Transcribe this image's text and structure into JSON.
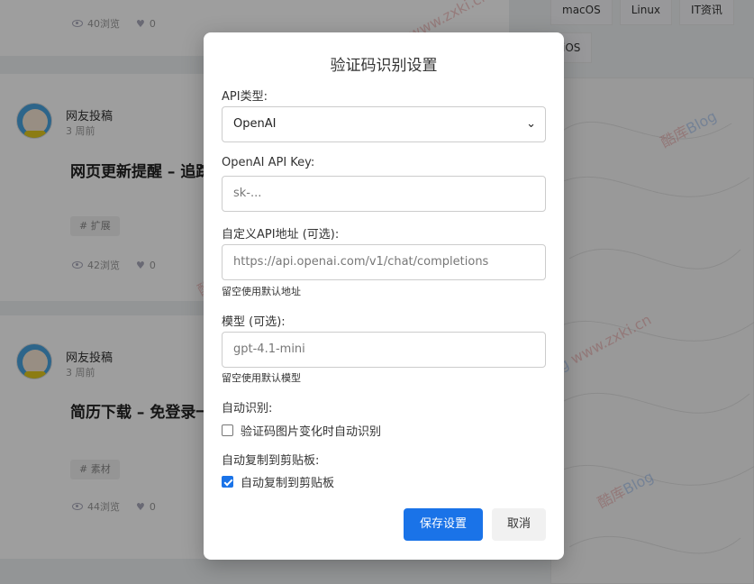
{
  "background": {
    "cards": [
      {
        "views": "40浏览",
        "likes": "0"
      },
      {
        "author": "网友投稿",
        "time": "3 周前",
        "title": "网页更新提醒 – 追踪",
        "tag": "# 扩展",
        "views": "42浏览",
        "likes": "0"
      },
      {
        "author": "网友投稿",
        "time": "3 周前",
        "title": "简历下载 – 免登录一",
        "tag": "# 素材",
        "views": "44浏览",
        "likes": "0"
      }
    ],
    "side_tags": [
      "macOS",
      "Linux",
      "IT资讯",
      "iOS"
    ],
    "watermark": {
      "main": "酷库",
      "blog": "Blog",
      "url": "www.zxki.cn"
    }
  },
  "modal": {
    "title": "验证码识别设置",
    "api_type_label": "API类型:",
    "api_type_value": "OpenAI",
    "api_key_label": "OpenAI API Key:",
    "api_key_placeholder": "sk-...",
    "api_url_label": "自定义API地址 (可选):",
    "api_url_placeholder": "https://api.openai.com/v1/chat/completions",
    "api_url_hint": "留空使用默认地址",
    "model_label": "模型 (可选):",
    "model_placeholder": "gpt-4.1-mini",
    "model_hint": "留空使用默认模型",
    "auto_recognize_label": "自动识别:",
    "auto_recognize_option": "验证码图片变化时自动识别",
    "auto_recognize_checked": false,
    "auto_copy_label": "自动复制到剪贴板:",
    "auto_copy_option": "自动复制到剪贴板",
    "auto_copy_checked": true,
    "save_button": "保存设置",
    "cancel_button": "取消"
  }
}
